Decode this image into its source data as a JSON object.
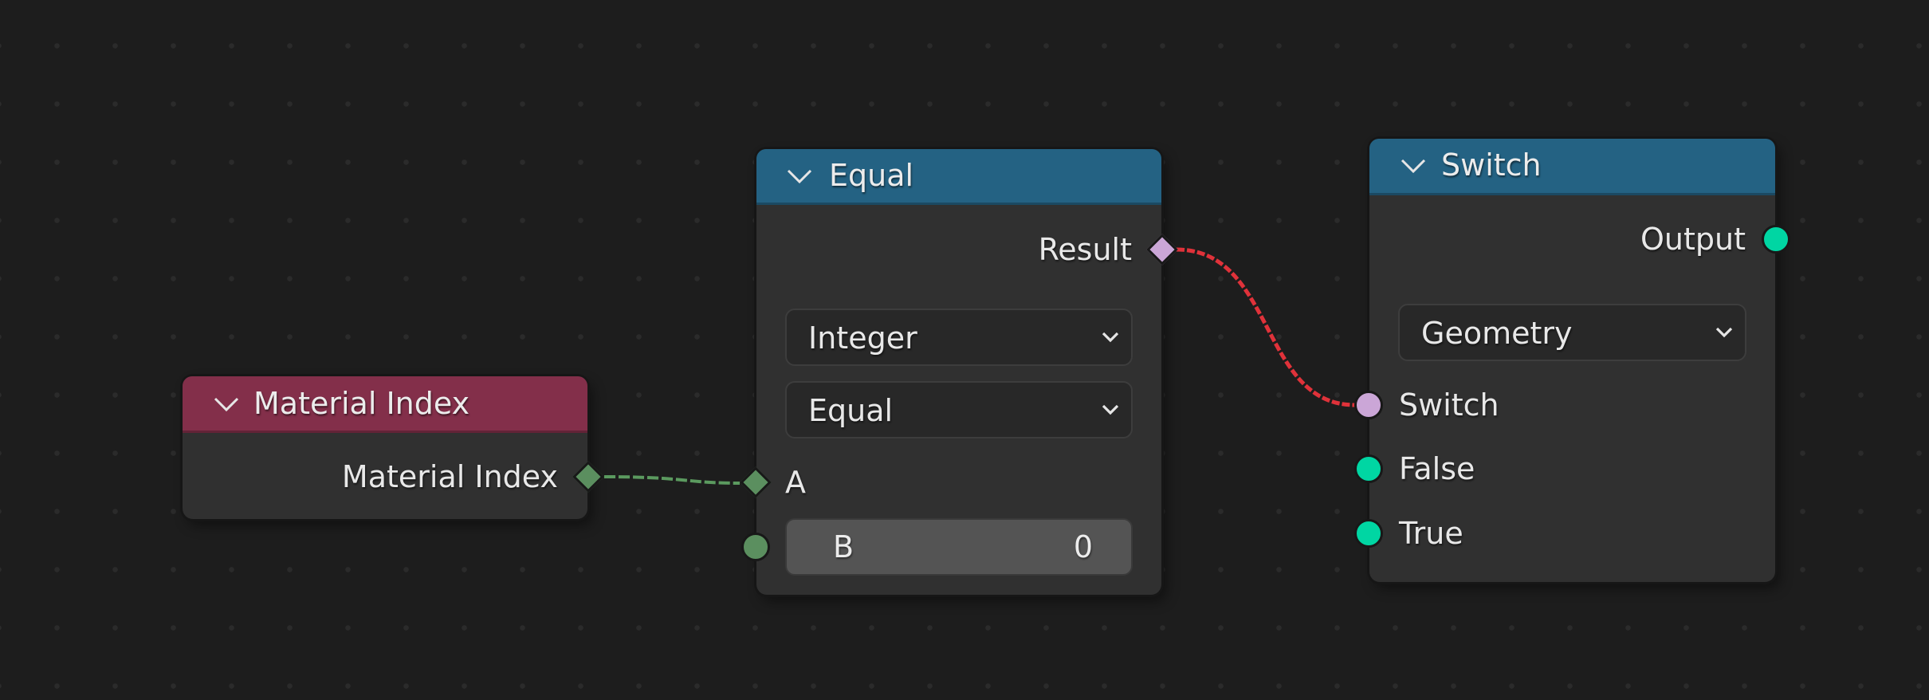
{
  "editor": {
    "type": "geometry-node-editor",
    "colors": {
      "background": "#1d1d1d",
      "node_body": "#303030",
      "header_input": "#832f4a",
      "header_utility": "#246283",
      "socket_field_int": "#5b8f5f",
      "socket_boolean": "#cba6d7",
      "socket_geometry": "#00d6a3",
      "link_valid": "#5b9a5f",
      "link_invalid": "#e0323a"
    }
  },
  "nodes": {
    "material_index": {
      "title": "Material Index",
      "collapse_icon": "chevron-down-icon",
      "outputs": [
        {
          "label": "Material Index",
          "type": "integer-field",
          "shape": "diamond"
        }
      ]
    },
    "equal": {
      "title": "Equal",
      "collapse_icon": "chevron-down-icon",
      "outputs": [
        {
          "label": "Result",
          "type": "boolean-field",
          "shape": "diamond"
        }
      ],
      "data_type_dropdown": {
        "value": "Integer"
      },
      "operation_dropdown": {
        "value": "Equal"
      },
      "inputs": [
        {
          "label": "A",
          "type": "integer-field",
          "shape": "diamond",
          "connected": true
        },
        {
          "label": "B",
          "type": "integer",
          "shape": "circle",
          "value": "0"
        }
      ]
    },
    "switch": {
      "title": "Switch",
      "collapse_icon": "chevron-down-icon",
      "outputs": [
        {
          "label": "Output",
          "type": "geometry",
          "shape": "circle"
        }
      ],
      "type_dropdown": {
        "value": "Geometry"
      },
      "inputs": [
        {
          "label": "Switch",
          "type": "boolean",
          "shape": "circle",
          "connected": true
        },
        {
          "label": "False",
          "type": "geometry",
          "shape": "circle"
        },
        {
          "label": "True",
          "type": "geometry",
          "shape": "circle"
        }
      ]
    }
  },
  "links": [
    {
      "from": "Material Index.Material Index",
      "to": "Equal.A",
      "status": "valid"
    },
    {
      "from": "Equal.Result",
      "to": "Switch.Switch",
      "status": "invalid"
    }
  ]
}
